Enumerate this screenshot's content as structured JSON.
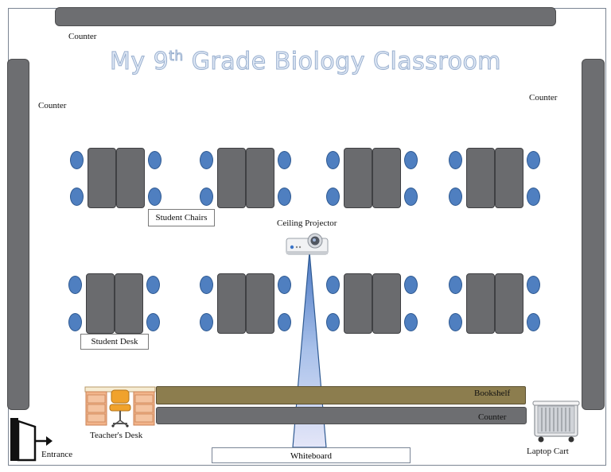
{
  "title": {
    "text_main": "My 9",
    "superscript": "th",
    "text_rest": " Grade Biology Classroom"
  },
  "labels": {
    "counter_top": "Counter",
    "counter_left": "Counter",
    "counter_right": "Counter",
    "counter_bottom": "Counter",
    "student_chairs": "Student Chairs",
    "student_desk": "Student Desk",
    "ceiling_projector": "Ceiling Projector",
    "bookshelf": "Bookshelf",
    "teachers_desk": "Teacher's Desk",
    "entrance": "Entrance",
    "whiteboard": "Whiteboard",
    "laptop_cart": "Laptop Cart"
  },
  "colors": {
    "counter": "#6d6e71",
    "desk": "#6a6b6e",
    "chair": "#4f7fc0",
    "bookshelf": "#8c7d4e",
    "projector_beam": "#b9cdef",
    "title": "#dfe8f5"
  },
  "icons": [
    "projector-icon",
    "teacher-desk-icon",
    "entrance-door-icon",
    "laptop-cart-icon"
  ]
}
